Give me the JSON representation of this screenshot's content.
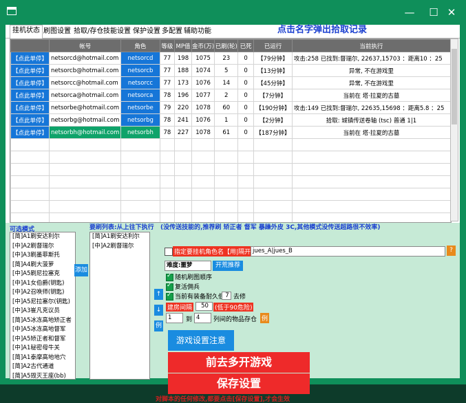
{
  "window": {
    "min": "—",
    "max": "☐",
    "close": "✕"
  },
  "tabs": [
    "挂机状态",
    "刷图设置",
    "拾取/存仓",
    "技能设置",
    "保护设置",
    "多配置",
    "辅助功能"
  ],
  "notice": "点击名字弹出拾取记录",
  "table": {
    "headers": [
      "",
      "帐号",
      "角色",
      "等级",
      "MP值",
      "金币(万)",
      "已刷(轮)",
      "已死",
      "已运行",
      "当前执行"
    ],
    "rows": [
      [
        "【点此单停】",
        "netsorcd@hotmail.com",
        "netsorcd",
        "77",
        "198",
        "1075",
        "23",
        "0",
        "【79分钟】",
        "攻击:258 已找到:督瑞尔, 22637,15703 ：距离10 ：25"
      ],
      [
        "【点此单停】",
        "netsorcb@hotmail.com",
        "netsorcb",
        "77",
        "188",
        "1074",
        "5",
        "0",
        "【13分钟】",
        "异常, 不在游戏里"
      ],
      [
        "【点此单停】",
        "netsorcc@hotmail.com",
        "netsorcc",
        "77",
        "173",
        "1076",
        "14",
        "0",
        "【45分钟】",
        "异常, 不在游戏里"
      ],
      [
        "【点此单停】",
        "netsorca@hotmail.com",
        "netsorca",
        "78",
        "196",
        "1077",
        "2",
        "0",
        "【7分钟】",
        "当前在 塔·拉夏的古墓"
      ],
      [
        "【点此单停】",
        "netsorbe@hotmail.com",
        "netsorbe",
        "79",
        "220",
        "1078",
        "60",
        "0",
        "【190分钟】",
        "攻击:149 已找到:督瑞尔, 22635,15698 ：距离5.8 ：25"
      ],
      [
        "【点此单停】",
        "netsorbg@hotmail.com",
        "netsorbg",
        "78",
        "241",
        "1076",
        "1",
        "0",
        "【2分钟】",
        "拾取: 城镇传送卷轴 (tsc) 普通 1|1"
      ],
      [
        "【点此单停】",
        "netsorbh@hotmail.com",
        "netsorbh",
        "78",
        "227",
        "1078",
        "61",
        "0",
        "【187分钟】",
        "当前在 塔·拉夏的古墓"
      ]
    ]
  },
  "lower": {
    "optional_label": "可选模式",
    "optional_items": [
      "[简]A1刷安达利尔",
      "[中]A2刷督瑞尔",
      "[中]A3刷墨菲斯托",
      "[简]A4刷大菠萝",
      "[中]A5刷尼拉塞克",
      "[中]A1女伯爵(钥匙)",
      "[中]A2召唤师(钥匙)",
      "[中]A5尼拉塞尔(钥匙)",
      "[中]A3崔凡克议员",
      "[简]A5冰冻高地矫正者",
      "[中]A5冰冻高地督军",
      "[中]A5矫正者和督军",
      "[中]A1秘密母牛关",
      "[简]A1泰摩高地地穴",
      "[简]A2古代通道",
      "[简]A5毁灭王座(bb)"
    ],
    "add_btn": "添加",
    "brush_label": "要刷列表:从上往下执行",
    "brush_items": [
      "[简]A1刷安达利尔",
      "[中]A2刷督瑞尔"
    ],
    "hint": "(没传送技能的,推荐刷 矫正者 督军 暴躁外皮 3C,其他模式没传送超路很不效率)",
    "role_label": "指定要挂机角色名【用|隔开】",
    "role_value": "jues_A|jues_B",
    "q": "?",
    "difficulty": "难度:噩梦",
    "recommend": "开荒推荐",
    "opt1": "随机刷图顺序",
    "opt2": "复活佣兵",
    "opt3a": "当前有装备耐久低于",
    "opt3v": "7",
    "opt3b": "去修",
    "interval_label": "建房间隔",
    "interval_value": "50",
    "interval_note": "(低于90危险)",
    "from": "1",
    "to_label": "到",
    "to": "4",
    "store_label": "列间的物品存仓",
    "example": "例",
    "up": "↑",
    "down": "↓",
    "example2": "例",
    "notes_btn": "游戏设置注意",
    "go_btn": "前去多开游戏",
    "save_btn": "保存设置",
    "warning": "对脚本的任何修改,都要点击[保存设置],才会生效"
  }
}
